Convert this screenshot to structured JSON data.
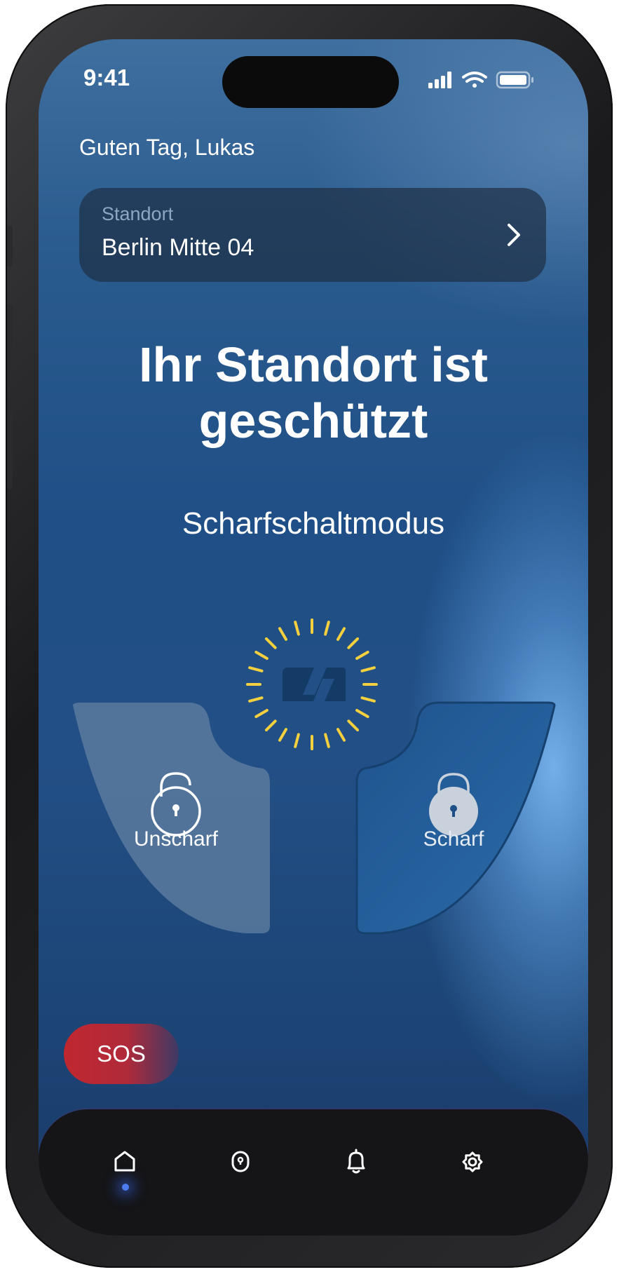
{
  "status_bar": {
    "time": "9:41"
  },
  "greeting": "Guten Tag, Lukas",
  "location": {
    "label": "Standort",
    "value": "Berlin Mitte 04"
  },
  "headline": {
    "line1": "Ihr Standort ist",
    "line2": "geschützt"
  },
  "mode_label": "Scharfschaltmodus",
  "arm_control": {
    "options": [
      {
        "label": "Unscharf",
        "selected": false
      },
      {
        "label": "Scharf",
        "selected": true
      }
    ]
  },
  "sos_label": "SOS",
  "tab_bar": {
    "items": [
      {
        "icon": "home-icon",
        "active": true
      },
      {
        "icon": "sensor-icon",
        "active": false
      },
      {
        "icon": "bell-icon",
        "active": false
      },
      {
        "icon": "gear-icon",
        "active": false
      }
    ]
  },
  "colors": {
    "accent_yellow": "#f4d03f",
    "sos_red": "#c0272f",
    "tab_active_dot": "#4d7cf0"
  }
}
